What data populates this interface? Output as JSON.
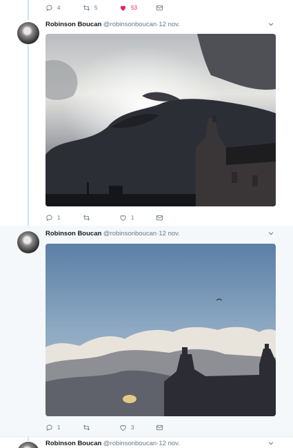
{
  "top_tweet": {
    "replies": "4",
    "retweets": "5",
    "likes": "53"
  },
  "tweets": [
    {
      "name": "Robinson Boucan",
      "handle": "@robinsonboucan",
      "separator": "·",
      "date": "12 nov.",
      "replies": "1",
      "retweets": "",
      "likes": "1"
    },
    {
      "name": "Robinson Boucan",
      "handle": "@robinsonboucan",
      "separator": "·",
      "date": "12 nov.",
      "replies": "1",
      "retweets": "",
      "likes": "3"
    },
    {
      "name": "Robinson Boucan",
      "handle": "@robinsonboucan",
      "separator": "·",
      "date": "12 nov."
    }
  ],
  "colors": {
    "thread_line": "#c4e6f5",
    "liked": "#e0245e",
    "muted": "#657786"
  }
}
